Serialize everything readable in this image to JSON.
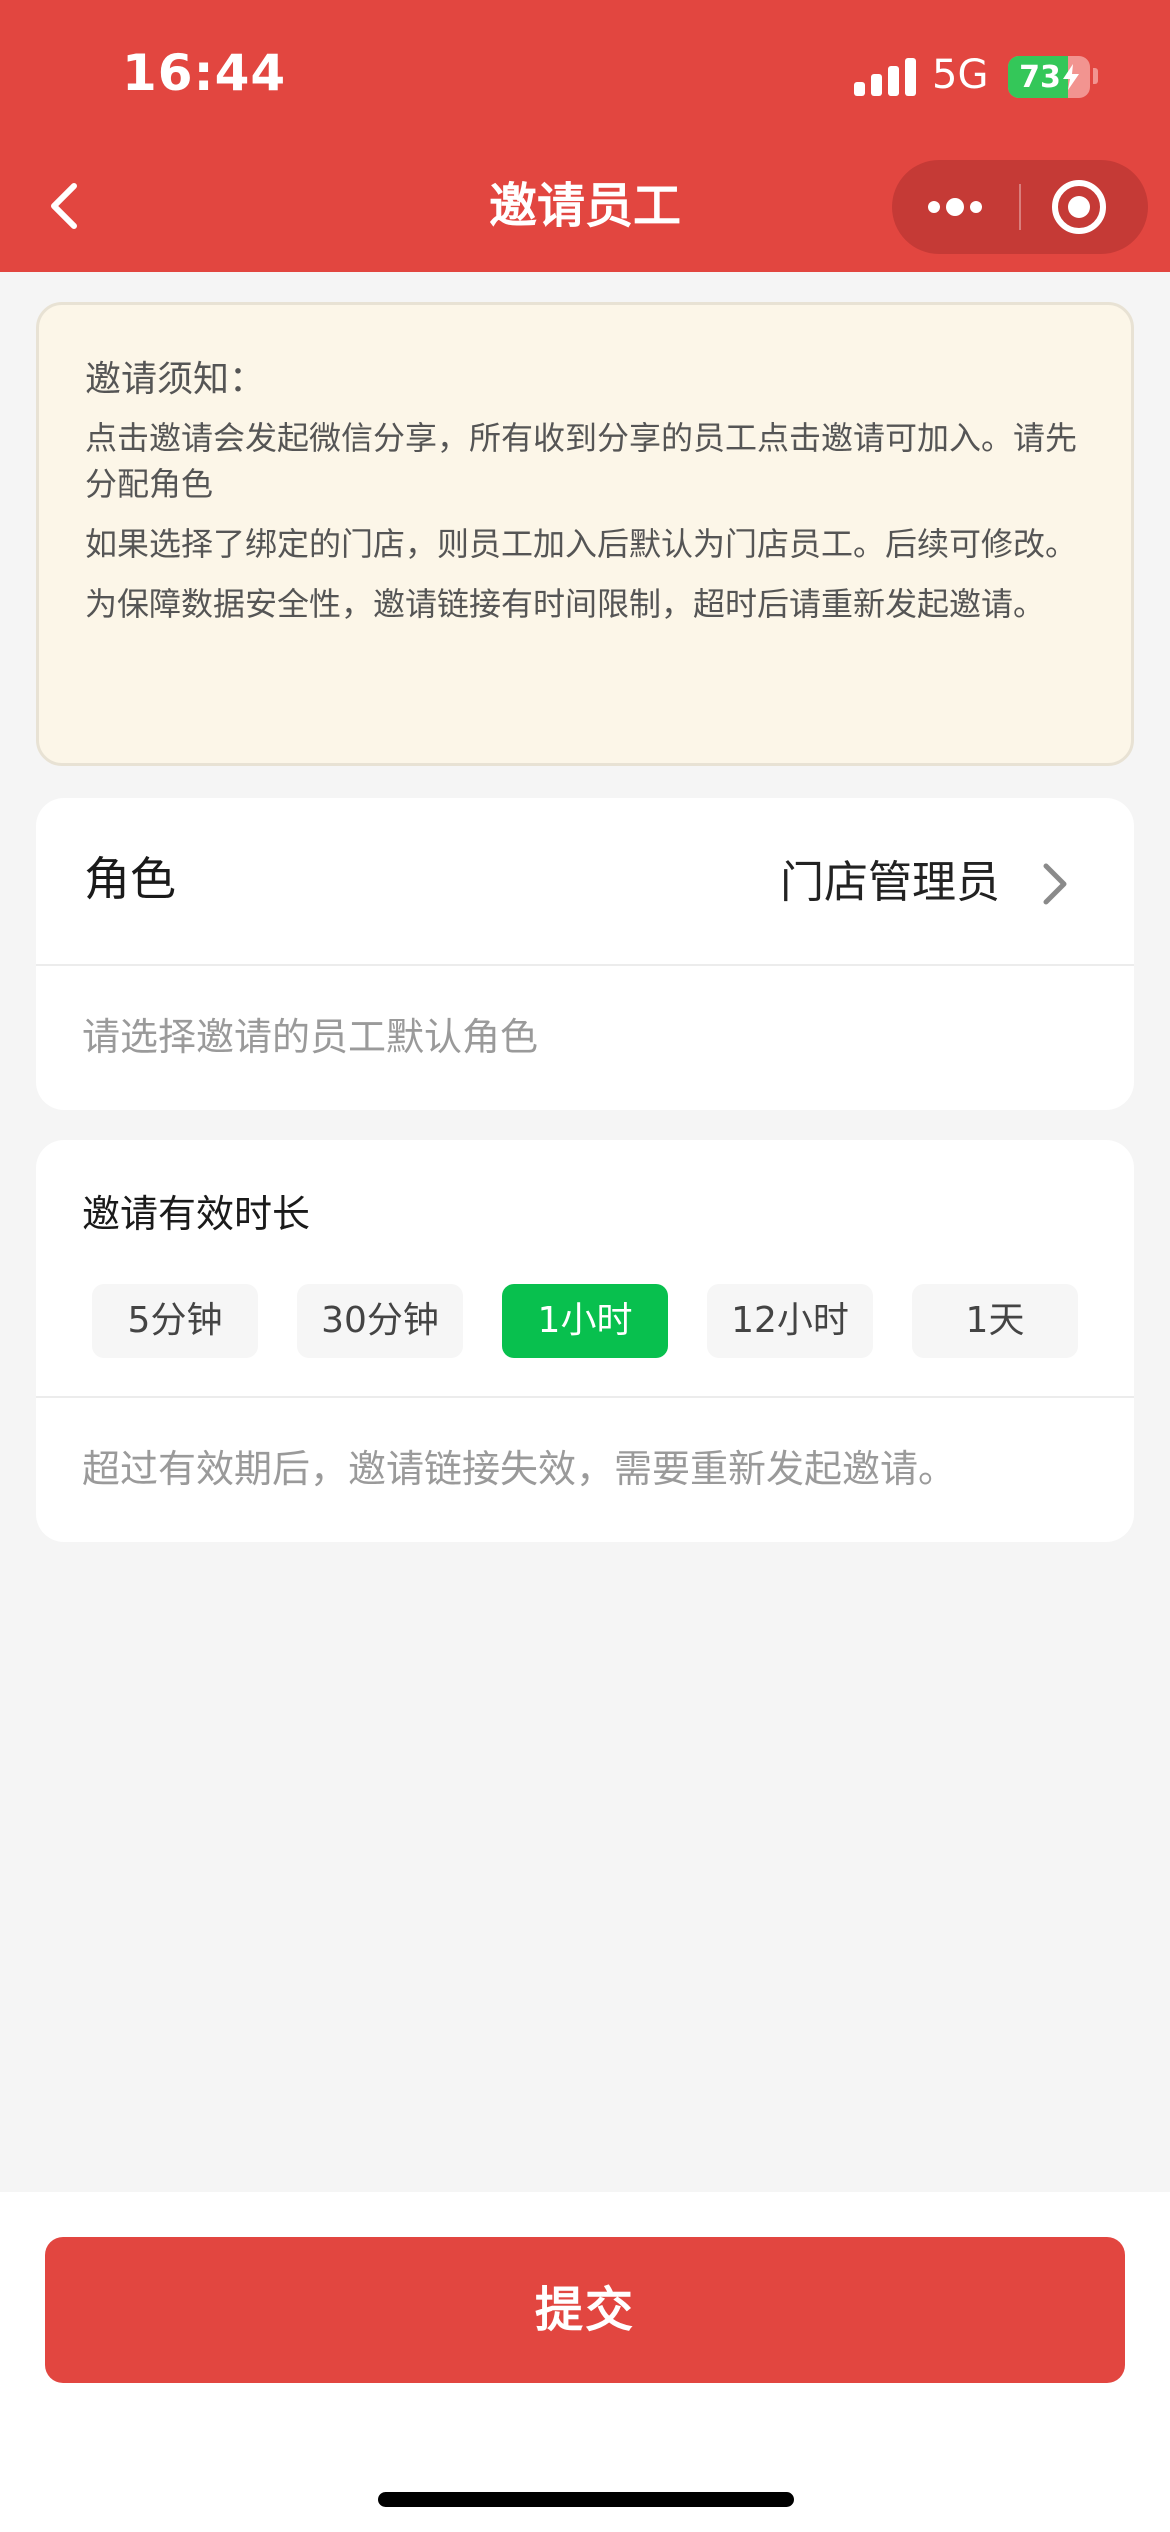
{
  "status_bar": {
    "time": "16:44",
    "network": "5G",
    "battery_level": "73",
    "battery_fraction": 0.73,
    "icons": [
      "signal-icon",
      "battery-charging-icon"
    ]
  },
  "nav": {
    "title": "邀请员工",
    "icons": [
      "back-chevron-icon",
      "more-icon",
      "close-target-icon"
    ]
  },
  "notice": {
    "title": "邀请须知：",
    "lines": [
      "点击邀请会发起微信分享，所有收到分享的员工点击邀请可加入。请先分配角色",
      "如果选择了绑定的门店，则员工加入后默认为门店员工。后续可修改。",
      "为保障数据安全性，邀请链接有时间限制，超时后请重新发起邀请。"
    ]
  },
  "role": {
    "label": "角色",
    "value": "门店管理员",
    "hint": "请选择邀请的员工默认角色"
  },
  "duration": {
    "title": "邀请有效时长",
    "options": [
      "5分钟",
      "30分钟",
      "1小时",
      "12小时",
      "1天"
    ],
    "selected": "1小时",
    "hint": "超过有效期后，邀请链接失效，需要重新发起邀请。"
  },
  "submit_label": "提交",
  "colors": {
    "brand_red": "#e24640",
    "selected_green": "#08c04e",
    "notice_bg": "#fcf6e8"
  }
}
